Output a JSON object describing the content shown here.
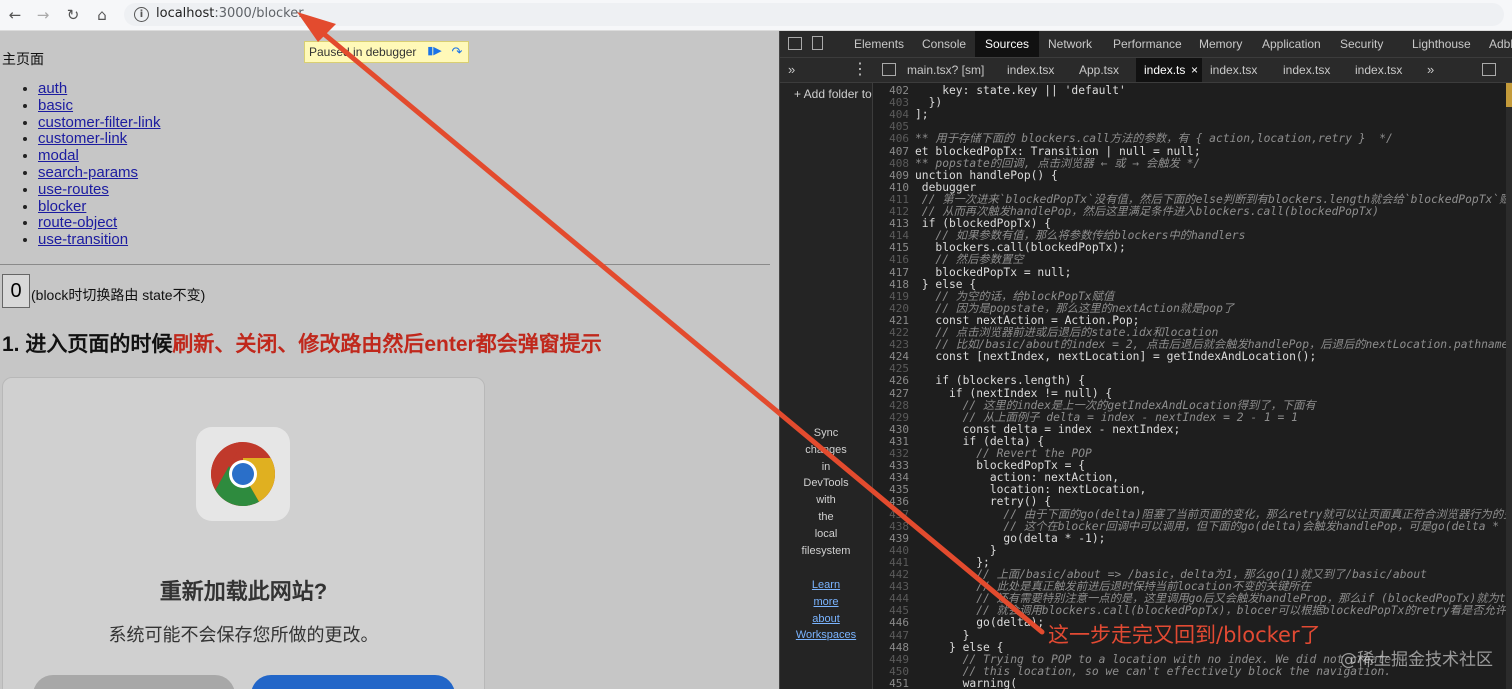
{
  "browser": {
    "url_host": "localhost",
    "url_path": ":3000/blocker"
  },
  "page": {
    "main_title": "主页面",
    "nav_links": [
      "auth",
      "basic",
      "customer-filter-link",
      "customer-link",
      "modal",
      "search-params",
      "use-routes",
      "blocker",
      "route-object",
      "use-transition"
    ],
    "counter_value": "0",
    "counter_note": "(block时切换路由 state不变)",
    "heading_prefix": "1. 进入页面的时候",
    "heading_highlight": "刷新、关闭、修改路由然后enter都会弹窗提示",
    "paused_text": "Paused in debugger",
    "dialog_title": "重新加载此网站?",
    "dialog_subtitle": "系统可能不会保存您所做的更改。"
  },
  "devtools": {
    "tabs": [
      "Elements",
      "Console",
      "Sources",
      "Network",
      "Performance",
      "Memory",
      "Application",
      "Security",
      "Lighthouse",
      "Adbl"
    ],
    "active_tab": "Sources",
    "file_tabs": [
      "main.tsx? [sm]",
      "index.tsx",
      "App.tsx",
      "index.ts",
      "index.tsx",
      "index.tsx",
      "index.tsx"
    ],
    "active_file": "index.ts",
    "add_folder": "+ Add folder to workspace",
    "sync_text": [
      "Sync",
      "changes",
      "in",
      "DevTools",
      "with",
      "the",
      "local",
      "filesystem"
    ],
    "learn_links": [
      "Learn",
      "more",
      "about",
      "Workspaces"
    ],
    "code": [
      {
        "n": "402",
        "t": "    key: state.key || 'default'",
        "c": false,
        "d": false
      },
      {
        "n": "403",
        "t": "  })",
        "c": false,
        "d": true
      },
      {
        "n": "404",
        "t": "];",
        "c": false,
        "d": true
      },
      {
        "n": "405",
        "t": "",
        "c": false,
        "d": true
      },
      {
        "n": "406",
        "t": "** 用于存储下面的 blockers.call方法的参数，有 { action,location,retry }  */",
        "c": true,
        "d": true
      },
      {
        "n": "407",
        "t": "et blockedPopTx: Transition | null = null;",
        "c": false,
        "d": false
      },
      {
        "n": "408",
        "t": "** popstate的回调, 点击浏览器 ← 或 → 会触发 */",
        "c": true,
        "d": true
      },
      {
        "n": "409",
        "t": "unction handlePop() {",
        "c": false,
        "d": false
      },
      {
        "n": "410",
        "t": " debugger",
        "c": false,
        "d": false
      },
      {
        "n": "411",
        "t": " // 第一次进来`blockedPopTx`没有值，然后下面的else判断到有blockers.length就会给`blockedPopTx`赋",
        "c": true,
        "d": true
      },
      {
        "n": "412",
        "t": " // 从而再次触发handlePop，然后这里满足条件进入blockers.call(blockedPopTx)",
        "c": true,
        "d": true
      },
      {
        "n": "413",
        "t": " if (blockedPopTx) {",
        "c": false,
        "d": false
      },
      {
        "n": "414",
        "t": "   // 如果参数有值，那么将参数传给blockers中的handlers",
        "c": true,
        "d": true
      },
      {
        "n": "415",
        "t": "   blockers.call(blockedPopTx);",
        "c": false,
        "d": false
      },
      {
        "n": "416",
        "t": "   // 然后参数置空",
        "c": true,
        "d": true
      },
      {
        "n": "417",
        "t": "   blockedPopTx = null;",
        "c": false,
        "d": false
      },
      {
        "n": "418",
        "t": " } else {",
        "c": false,
        "d": false
      },
      {
        "n": "419",
        "t": "   // 为空的话，给blockPopTx赋值",
        "c": true,
        "d": true
      },
      {
        "n": "420",
        "t": "   // 因为是popstate，那么这里的nextAction就是pop了",
        "c": true,
        "d": true
      },
      {
        "n": "421",
        "t": "   const nextAction = Action.Pop;",
        "c": false,
        "d": false
      },
      {
        "n": "422",
        "t": "   // 点击浏览器前进或后退后的state.idx和location",
        "c": true,
        "d": true
      },
      {
        "n": "423",
        "t": "   // 比如/basic/about的index = 2, 点击后退后就会触发handlePop，后退后的nextLocation.pathname",
        "c": true,
        "d": true
      },
      {
        "n": "424",
        "t": "   const [nextIndex, nextLocation] = getIndexAndLocation();",
        "c": false,
        "d": false
      },
      {
        "n": "425",
        "t": "",
        "c": false,
        "d": true
      },
      {
        "n": "426",
        "t": "   if (blockers.length) {",
        "c": false,
        "d": false
      },
      {
        "n": "427",
        "t": "     if (nextIndex != null) {",
        "c": false,
        "d": false
      },
      {
        "n": "428",
        "t": "       // 这里的index是上一次的getIndexAndLocation得到了，下面有",
        "c": true,
        "d": true
      },
      {
        "n": "429",
        "t": "       // 从上面例子 delta = index - nextIndex = 2 - 1 = 1",
        "c": true,
        "d": true
      },
      {
        "n": "430",
        "t": "       const delta = index - nextIndex;",
        "c": false,
        "d": false
      },
      {
        "n": "431",
        "t": "       if (delta) {",
        "c": false,
        "d": false
      },
      {
        "n": "432",
        "t": "         // Revert the POP",
        "c": true,
        "d": true
      },
      {
        "n": "433",
        "t": "         blockedPopTx = {",
        "c": false,
        "d": false
      },
      {
        "n": "434",
        "t": "           action: nextAction,",
        "c": false,
        "d": false
      },
      {
        "n": "435",
        "t": "           location: nextLocation,",
        "c": false,
        "d": false
      },
      {
        "n": "436",
        "t": "           retry() {",
        "c": false,
        "d": false
      },
      {
        "n": "437",
        "t": "             // 由于下面的go(delta)阻塞了当前页面的变化，那么retry就可以让页面真正符合浏览器行为的变",
        "c": true,
        "d": true
      },
      {
        "n": "438",
        "t": "             // 这个在blocker回调中可以调用，但下面的go(delta)会触发handlePop，可是go(delta * -",
        "c": true,
        "d": true
      },
      {
        "n": "439",
        "t": "             go(delta * -1);",
        "c": false,
        "d": false
      },
      {
        "n": "440",
        "t": "           }",
        "c": false,
        "d": true
      },
      {
        "n": "441",
        "t": "         };",
        "c": false,
        "d": true
      },
      {
        "n": "442",
        "t": "         // 上面/basic/about => /basic，delta为1，那么go(1)就又到了/basic/about",
        "c": true,
        "d": true
      },
      {
        "n": "443",
        "t": "         // 此处是真正触发前进后退时保持当前location不变的关键所在",
        "c": true,
        "d": true
      },
      {
        "n": "444",
        "t": "         // 还有需要特别注意一点的是，这里调用go后又会触发handleProp，那么if (blockedPopTx)就为t",
        "c": true,
        "d": true
      },
      {
        "n": "445",
        "t": "         // 就会调用blockers.call(blockedPopTx)，blocer可以根据blockedPopTx的retry看是否允许跳",
        "c": true,
        "d": true
      },
      {
        "n": "446",
        "t": "         go(delta);",
        "c": false,
        "d": false
      },
      {
        "n": "447",
        "t": "       }",
        "c": false,
        "d": true
      },
      {
        "n": "448",
        "t": "     } else {",
        "c": false,
        "d": false
      },
      {
        "n": "449",
        "t": "       // Trying to POP to a location with no index. We did not create",
        "c": true,
        "d": true
      },
      {
        "n": "450",
        "t": "       // this location, so we can't effectively block the navigation.",
        "c": true,
        "d": true
      },
      {
        "n": "451",
        "t": "       warning(",
        "c": false,
        "d": false
      }
    ]
  },
  "annotation": {
    "text": "这一步走完又回到/blocker了",
    "color": "#e24a33"
  },
  "watermark": "@稀土掘金技术社区"
}
